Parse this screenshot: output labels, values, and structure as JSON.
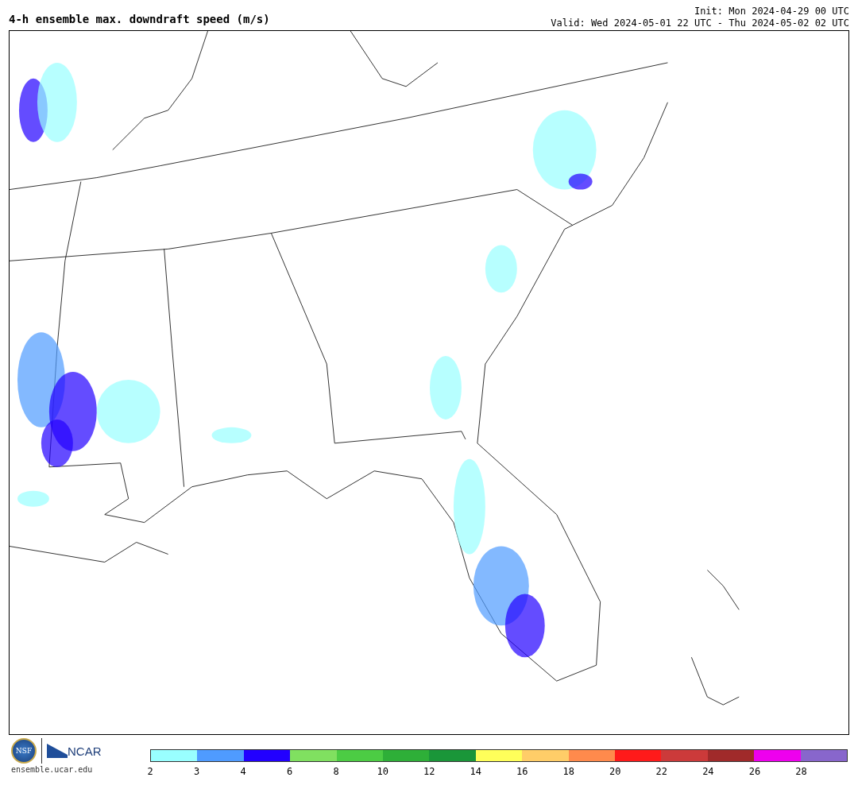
{
  "header": {
    "title": "4-h ensemble max. downdraft speed (m/s)",
    "init": "Init: Mon 2024-04-29 00 UTC",
    "valid": "Valid: Wed 2024-05-01 22 UTC - Thu 2024-05-02 02 UTC"
  },
  "logos": {
    "nsf": "NSF",
    "ncar": "NCAR",
    "url": "ensemble.ucar.edu"
  },
  "colorbar": {
    "segments": [
      {
        "color": "#99ffff",
        "label": "2"
      },
      {
        "color": "#4f9bff",
        "label": "3"
      },
      {
        "color": "#2200ff",
        "label": "4"
      },
      {
        "color": "#80e060",
        "label": "6"
      },
      {
        "color": "#4ccc44",
        "label": "8"
      },
      {
        "color": "#2eaf38",
        "label": "10"
      },
      {
        "color": "#1a9639",
        "label": "12"
      },
      {
        "color": "#ffff5a",
        "label": "14"
      },
      {
        "color": "#ffcd68",
        "label": "16"
      },
      {
        "color": "#ff8a4c",
        "label": "18"
      },
      {
        "color": "#ff1a1a",
        "label": "20"
      },
      {
        "color": "#cc3a3a",
        "label": "22"
      },
      {
        "color": "#a02a2a",
        "label": "24"
      },
      {
        "color": "#ee00ee",
        "label": "26"
      },
      {
        "color": "#8866cc",
        "label": "28"
      }
    ]
  }
}
